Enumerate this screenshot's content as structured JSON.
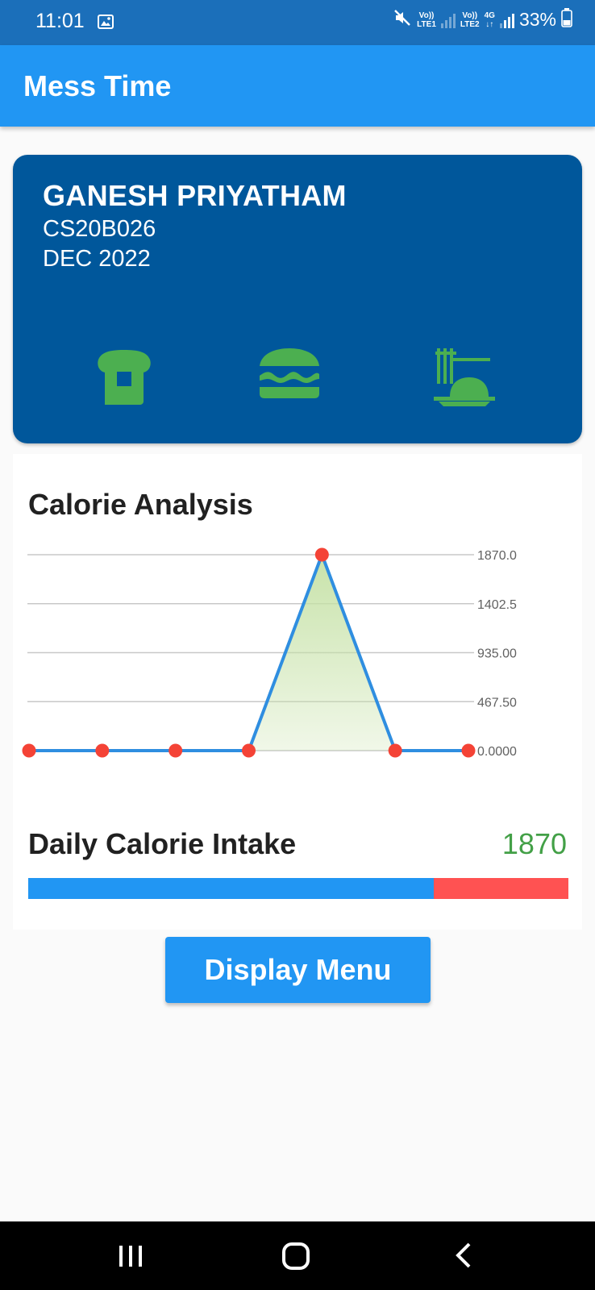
{
  "status_bar": {
    "time": "11:01",
    "sim1_label": "Vo))",
    "sim1_network": "LTE1",
    "sim2_label": "Vo))",
    "sim2_network": "LTE2",
    "data_type": "4G",
    "battery": "33%",
    "icons": [
      "gallery-icon",
      "mute-icon",
      "signal-icon",
      "battery-icon"
    ]
  },
  "app_bar": {
    "title": "Mess Time"
  },
  "profile": {
    "name": "GANESH PRIYATHAM",
    "roll_number": "CS20B026",
    "month": "DEC 2022",
    "meal_icons": [
      "breakfast-toast-icon",
      "lunch-burger-icon",
      "dinner-noodles-icon"
    ],
    "icon_color": "#4caf50"
  },
  "calorie_section": {
    "title": "Calorie Analysis",
    "daily_label": "Daily Calorie Intake",
    "daily_value": "1870",
    "progress_fraction": 0.75
  },
  "chart_data": {
    "type": "area",
    "x": [
      1,
      2,
      3,
      4,
      5,
      6,
      7
    ],
    "values": [
      0,
      0,
      0,
      0,
      1870,
      0,
      0
    ],
    "y_ticks": [
      "1870.0",
      "1402.5",
      "935.00",
      "467.50",
      "0.0000"
    ],
    "ylim": [
      0,
      1870
    ],
    "grid": true,
    "line_color": "#2f8ee0",
    "point_color": "#f44336",
    "fill_color": "#c5e1a5"
  },
  "buttons": {
    "display_menu": "Display Menu"
  },
  "nav_bar": {
    "icons": [
      "recent-apps-icon",
      "home-icon",
      "back-icon"
    ]
  }
}
